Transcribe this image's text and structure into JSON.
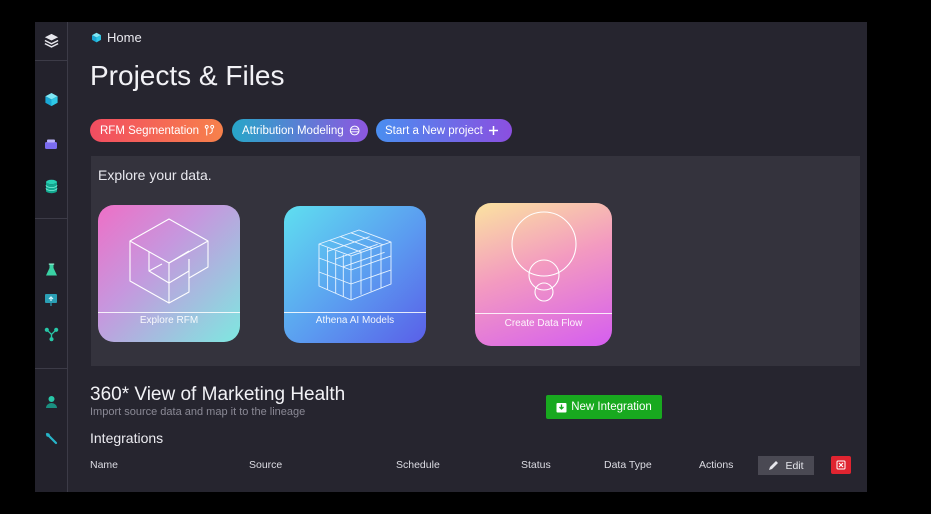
{
  "breadcrumb": {
    "label": "Home"
  },
  "page": {
    "title": "Projects & Files"
  },
  "quick_actions": [
    {
      "label": "RFM Segmentation"
    },
    {
      "label": "Attribution Modeling"
    },
    {
      "label": "Start a New project"
    }
  ],
  "explore": {
    "title": "Explore your data.",
    "cards": [
      {
        "label": "Explore RFM"
      },
      {
        "label": "Athena AI Models"
      },
      {
        "label": "Create Data Flow"
      }
    ]
  },
  "marketing_health": {
    "title": "360* View of Marketing Health",
    "subtitle": "Import source data and map it to the lineage",
    "new_integration_label": "New Integration"
  },
  "integrations": {
    "title": "Integrations",
    "columns": [
      "Name",
      "Source",
      "Schedule",
      "Status",
      "Data Type",
      "Actions"
    ],
    "edit_label": "Edit"
  },
  "colors": {
    "accent_cyan": "#2ec8e6",
    "new_integration_green": "#18a91f",
    "delete_red": "#e02430"
  },
  "icons": {
    "sidebar": [
      "layers-icon",
      "cube-icon",
      "inbox-icon",
      "database-icon",
      "flask-icon",
      "presentation-icon",
      "flow-icon",
      "user-icon",
      "wrench-icon"
    ]
  }
}
